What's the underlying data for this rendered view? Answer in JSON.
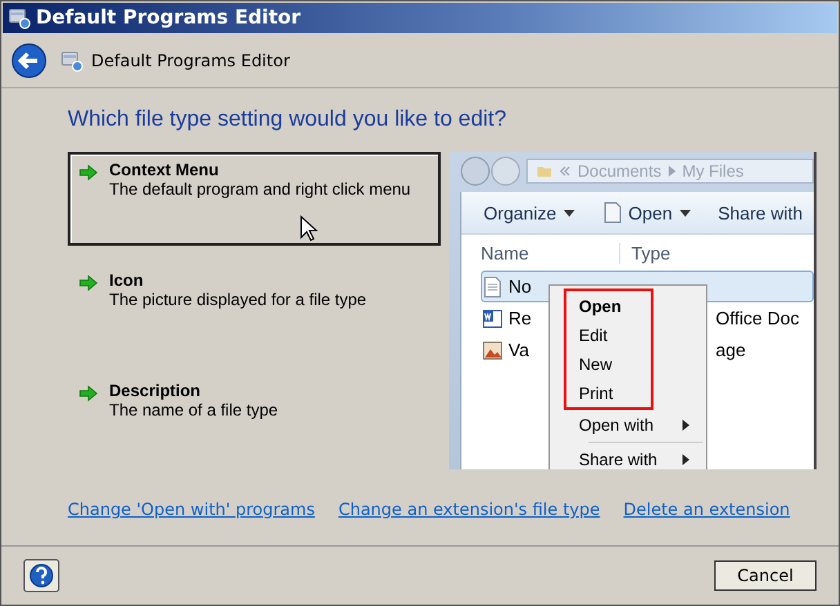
{
  "window": {
    "title": "Default Programs Editor"
  },
  "nav": {
    "breadcrumb": "Default Programs Editor"
  },
  "heading": "Which file type setting would you like to edit?",
  "options": [
    {
      "title": "Context Menu",
      "description": "The default program and right click menu",
      "selected": true
    },
    {
      "title": "Icon",
      "description": "The picture displayed for a file type",
      "selected": false
    },
    {
      "title": "Description",
      "description": "The name of a file type",
      "selected": false
    }
  ],
  "preview": {
    "address": [
      "Documents",
      "My Files"
    ],
    "toolbar": [
      {
        "label": "Organize",
        "kind": "menu"
      },
      {
        "label": "Open",
        "kind": "open"
      },
      {
        "label": "Share with",
        "kind": "plain"
      }
    ],
    "columns": [
      "Name",
      "Type"
    ],
    "files": [
      {
        "name": "No",
        "kind": "text",
        "selected": true
      },
      {
        "name": "Re",
        "type": "Office Doc",
        "kind": "word",
        "selected": false
      },
      {
        "name": "Va",
        "type": "age",
        "kind": "image",
        "selected": false
      }
    ],
    "menu": [
      {
        "label": "Open",
        "bold": true,
        "highlighted": true,
        "submenu": false
      },
      {
        "label": "Edit",
        "bold": false,
        "highlighted": true,
        "submenu": false
      },
      {
        "label": "New",
        "bold": false,
        "highlighted": true,
        "submenu": false
      },
      {
        "label": "Print",
        "bold": false,
        "highlighted": true,
        "submenu": false
      },
      {
        "label": "Open with",
        "bold": false,
        "highlighted": false,
        "submenu": true
      },
      {
        "label": "Share with",
        "bold": false,
        "highlighted": false,
        "submenu": true,
        "separator_before": true
      }
    ]
  },
  "links": [
    "Change 'Open with' programs",
    "Change an extension's file type",
    "Delete an extension"
  ],
  "buttons": [
    "Cancel"
  ]
}
